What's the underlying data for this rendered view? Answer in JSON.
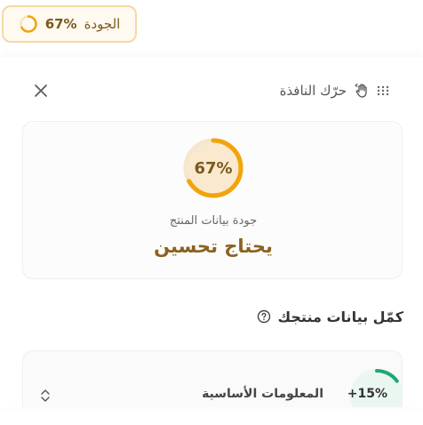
{
  "quality_pill": {
    "label": "الجودة",
    "value_text": "67%",
    "progress": 0.67,
    "ring_color": "#f2a40b"
  },
  "panel": {
    "move_label": "حرّك النافذة",
    "icons": {
      "close": "close-icon",
      "move": "hand-move-icon",
      "grip": "grip-dots-icon"
    }
  },
  "score_card": {
    "percent_text": "67%",
    "progress": 0.67,
    "caption": "جودة بيانات المنتج",
    "verdict": "يحتاج تحسين",
    "ring_color": "#f2a40b",
    "ring_fill": "#fbe9cf"
  },
  "section": {
    "title": "كمّل بيانات منتجك",
    "help_icon": "question-circle-icon"
  },
  "rows": [
    {
      "label": "المعلومات الأساسية",
      "badge_text": "+15%",
      "badge_progress": 0.15,
      "badge_color": "#1fa870",
      "toggle_icon": "chevron-up-down-icon"
    }
  ]
}
